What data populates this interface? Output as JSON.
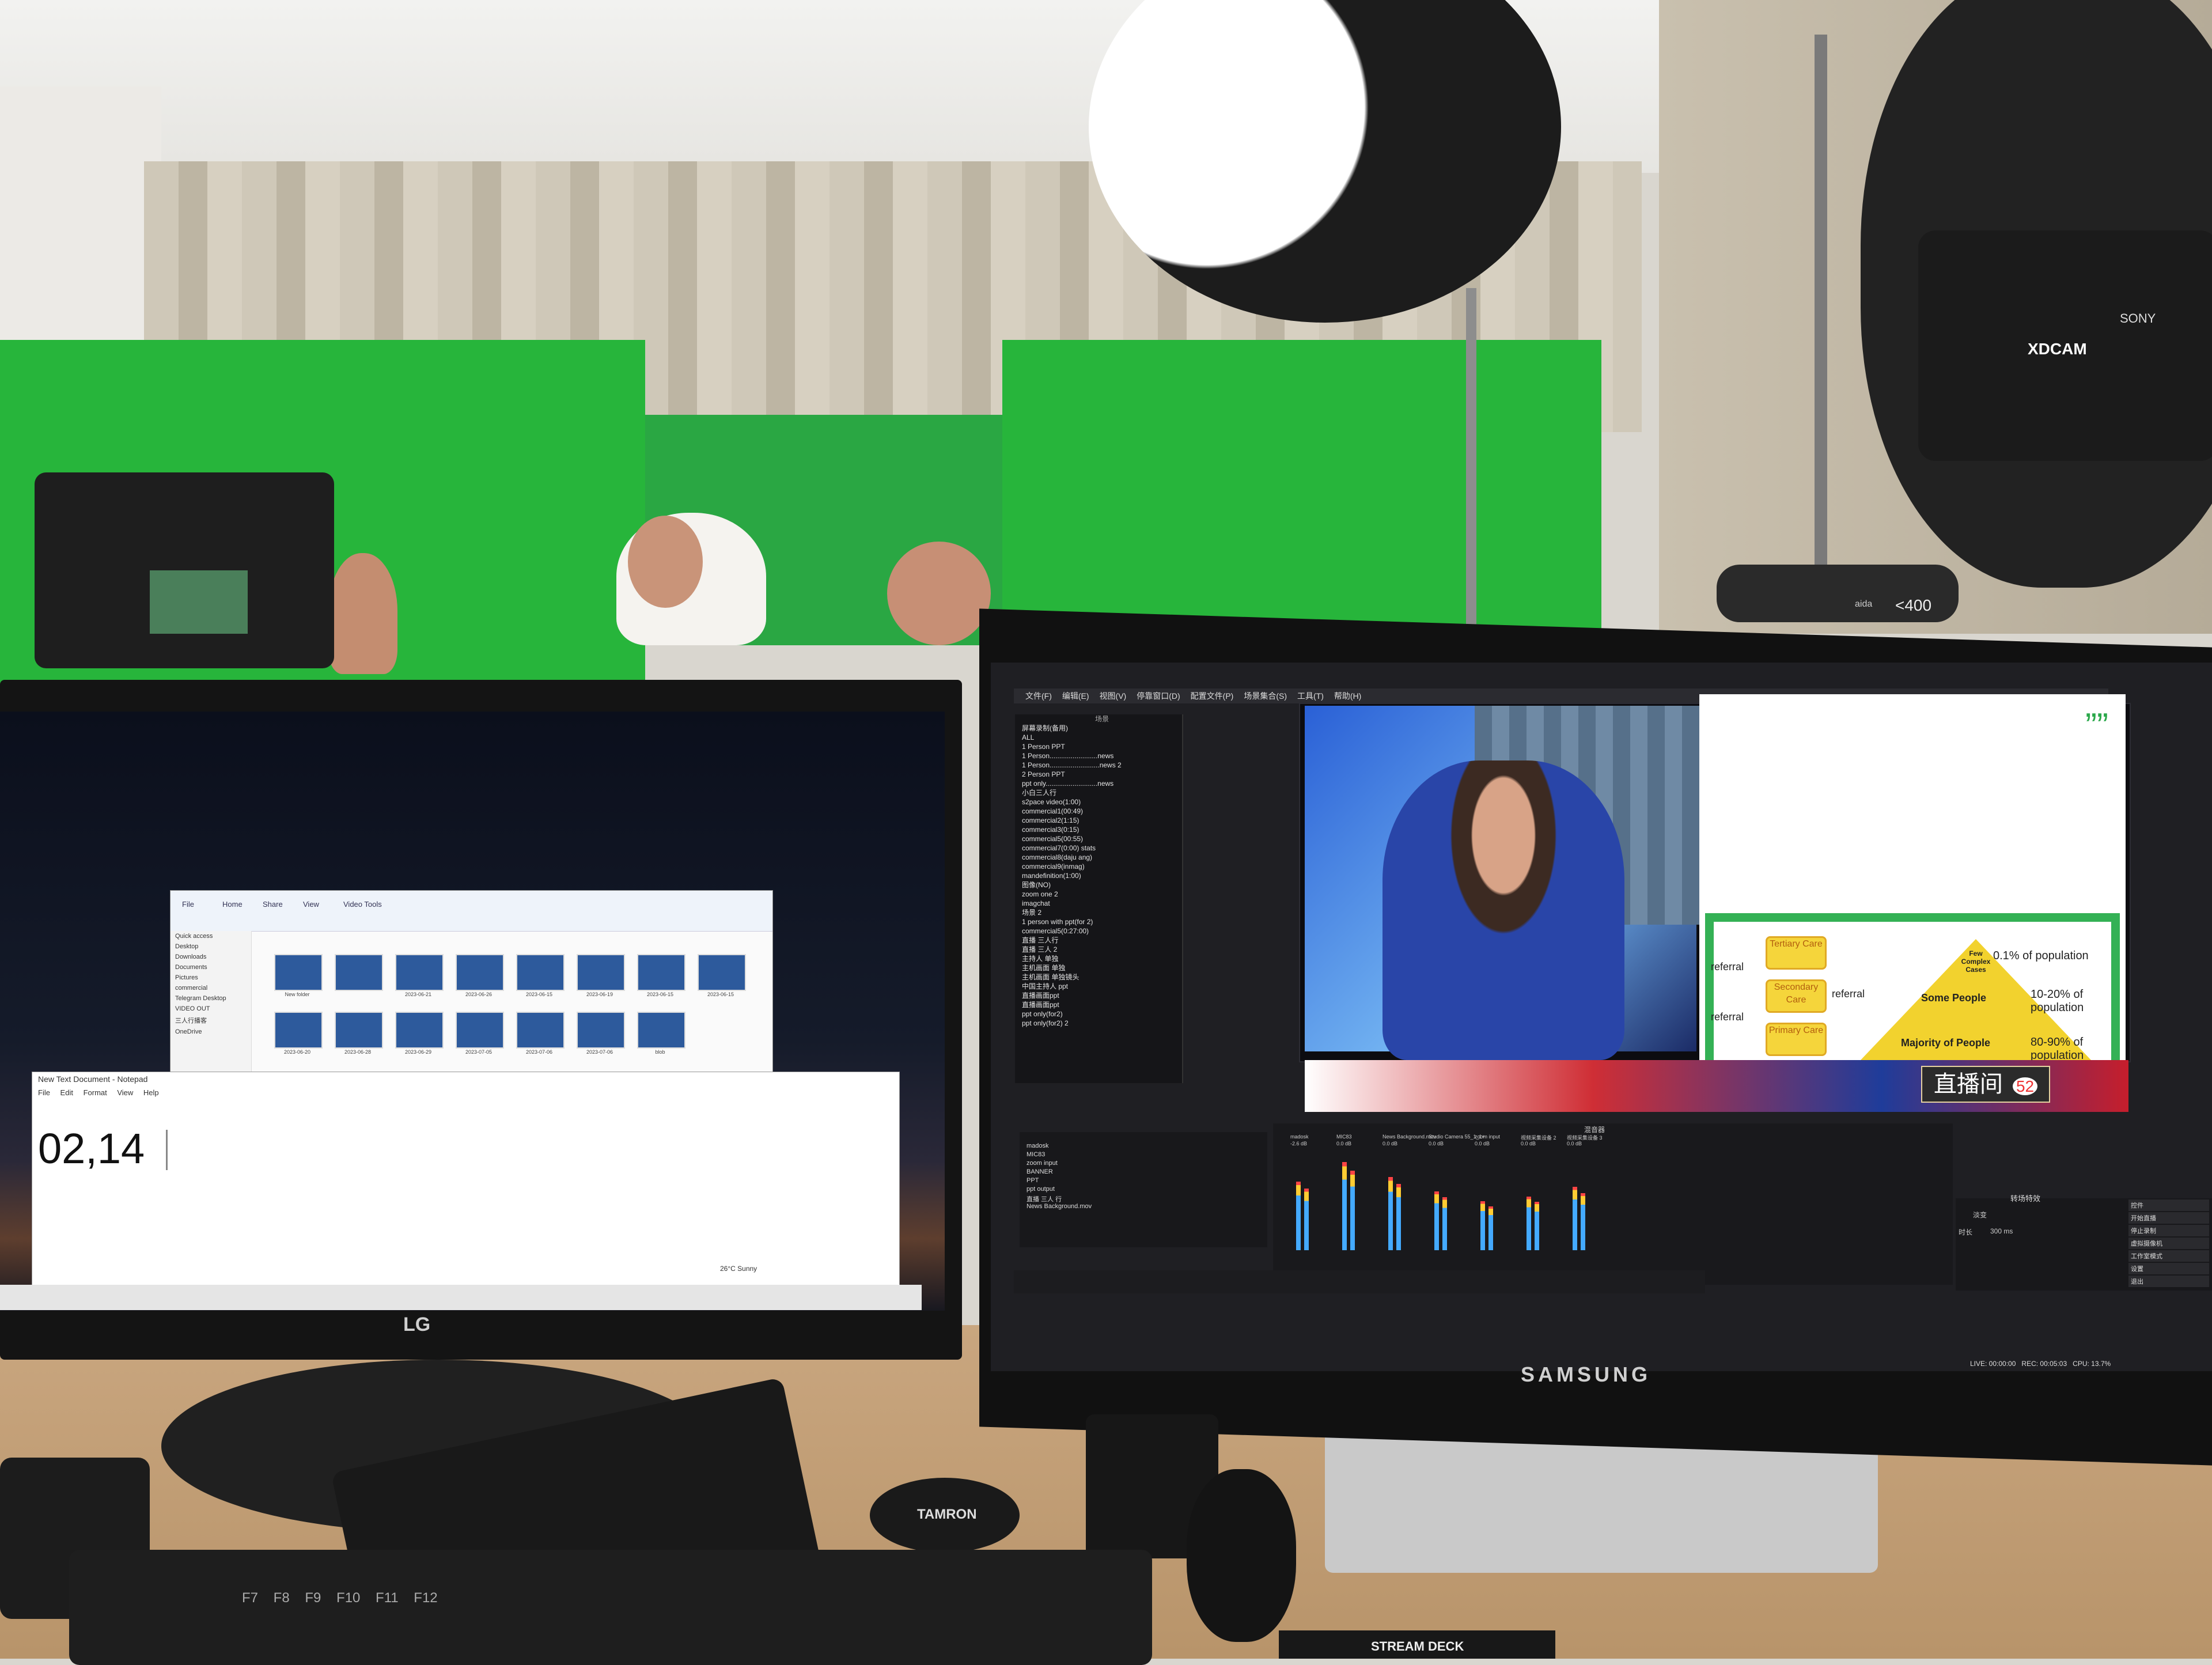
{
  "studio": {
    "camera_brand": "XDCAM",
    "camera_maker": "SONY",
    "camera2_model": "<400",
    "camera2_brand": "aida",
    "lens_cap_text": "TAMRON",
    "stream_deck_text": "STREAM DECK"
  },
  "lg_monitor": {
    "logo": "LG",
    "explorer": {
      "tabs": [
        "File",
        "Home",
        "Share",
        "View",
        "Video Tools"
      ],
      "nav_items": [
        "Quick access",
        "Desktop",
        "Downloads",
        "Documents",
        "Pictures",
        "commercial",
        "Telegram Desktop",
        "VIDEO OUT",
        "三人行播客",
        "OneDrive"
      ],
      "thumbs_row1": [
        "New folder",
        "",
        "2023-06-21",
        "2023-06-26",
        "2023-06-15",
        "2023-06-19",
        "2023-06-15",
        "2023-06-15"
      ],
      "thumbs_row2": [
        "2023-06-20",
        "2023-06-28",
        "2023-06-29",
        "2023-07-05",
        "2023-07-06",
        "2023-07-06",
        "blob"
      ]
    },
    "notepad": {
      "title": "New Text Document - Notepad",
      "menu": "File Edit Format View Help",
      "content": "02,14"
    },
    "taskbar": {
      "weather": "26°C Sunny"
    }
  },
  "samsung_monitor": {
    "logo": "SAMSUNG",
    "obs": {
      "menus": [
        "文件(F)",
        "编辑(E)",
        "视图(V)",
        "停靠窗口(D)",
        "配置文件(P)",
        "场景集合(S)",
        "工具(T)",
        "帮助(H)"
      ],
      "scene_header": "场景",
      "scenes": [
        "屏幕录制(备用)",
        "ALL",
        "1 Person PPT",
        "1 Person.........................news",
        "1 Person..........................news 2",
        "2 Person PPT",
        "ppt only...........................news",
        "小白三人行",
        "s2pace video(1:00)",
        "commercial1(00:49)",
        "commercial2(1:15)",
        "commercial3(0:15)",
        "commercial5(00:55)",
        "commercial7(0:00) stats",
        "commercial8(daju ang)",
        "commercial9(inmag)",
        "mandefinition(1:00)",
        "图像(NO)",
        "zoom one 2",
        "imagchat",
        "场景 2",
        "1 person with ppt(for 2)",
        "commercial5(0:27:00)",
        "直播 三人行",
        "直播 三人 2",
        "主持人 单独",
        "主机画面 单独",
        "主机画面 单独镜头",
        "中国主持人 ppt",
        "直播画面ppt",
        "直播画面ppt",
        "ppt only(for2)",
        "ppt only(for2) 2"
      ],
      "sources": [
        "madosk",
        "MIC83",
        "zoom input",
        "BANNER",
        "PPT",
        "ppt output",
        "直播 三人 行",
        "News Background.mov"
      ],
      "slide": {
        "quote_mark": "””",
        "tiers": [
          "Tertiary Care",
          "Secondary Care",
          "Primary Care"
        ],
        "pyramid_top": "Few Complex Cases",
        "pyramid_mid": "Some People",
        "pyramid_bottom": "Majority of People",
        "referral_1": "referral",
        "referral_2": "referral",
        "referral_3": "referral",
        "pct_top": "0.1% of population",
        "pct_mid": "10-20% of population",
        "pct_bottom": "80-90% of population"
      },
      "live_badge": "直播间",
      "live_badge_number": "52",
      "mixer_header": "混音器",
      "mixer_channels": [
        {
          "name": "madosk",
          "db": "-2.6 dB"
        },
        {
          "name": "MIC83",
          "db": "0.0 dB"
        },
        {
          "name": "News Background.mov",
          "db": "0.0 dB"
        },
        {
          "name": "Studio Camera 55_1_1+",
          "db": "0.0 dB"
        },
        {
          "name": "zoom input",
          "db": "0.0 dB"
        },
        {
          "name": "视频采集设备 2",
          "db": "0.0 dB"
        },
        {
          "name": "视频采集设备 3",
          "db": "0.0 dB"
        }
      ],
      "meter_levels": [
        0.7,
        0.9,
        0.75,
        0.6,
        0.5,
        0.55,
        0.65
      ],
      "transitions_header": "转场特效",
      "transition_value": "淡变",
      "duration_label": "时长",
      "duration_value": "300 ms",
      "controls": [
        "控件",
        "开始直播",
        "停止录制",
        "虚拟摄像机",
        "工作室模式",
        "设置",
        "退出"
      ],
      "status": {
        "live": "LIVE: 00:00:00",
        "rec": "REC: 00:05:03",
        "cpu": "CPU: 13.7%"
      }
    }
  },
  "keyboard_keys": "F7 F8 F9 F10 F11 F12"
}
